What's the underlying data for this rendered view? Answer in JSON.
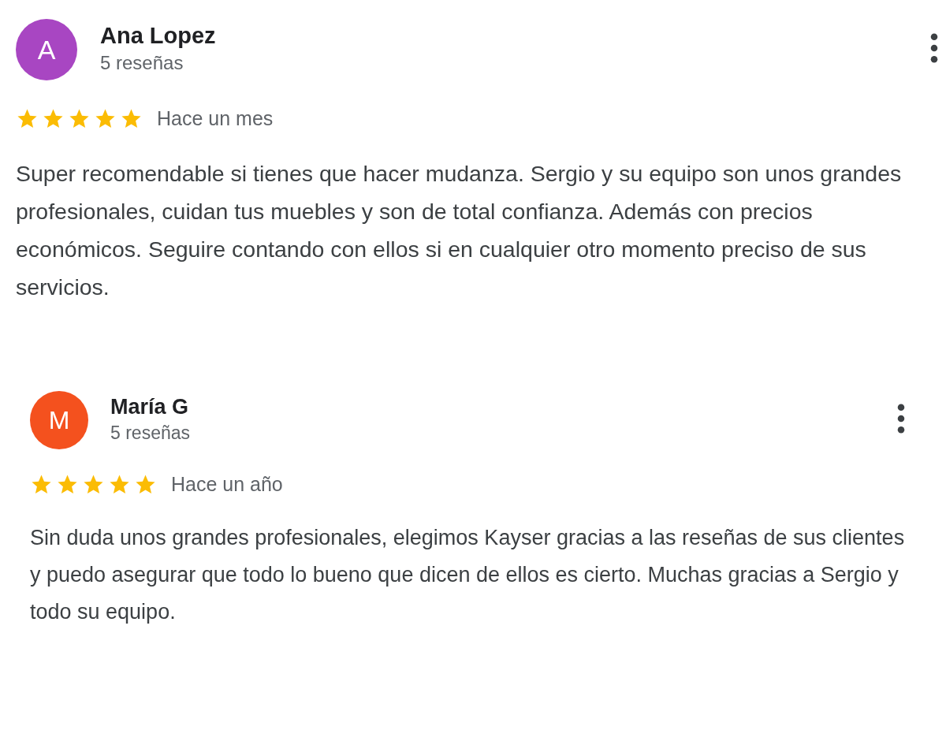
{
  "reviews": [
    {
      "initial": "A",
      "color": "#a846c2",
      "name": "Ana Lopez",
      "count": "5 reseñas",
      "stars": 5,
      "time": "Hace un mes",
      "text": "Super recomendable si tienes que hacer mudanza. Sergio y su equipo son unos grandes profesionales, cuidan tus muebles y son de total confianza. Además con precios económicos. Seguire contando con ellos si en cualquier otro momento preciso de sus servicios."
    },
    {
      "initial": "M",
      "color": "#f4511e",
      "name": "María G",
      "count": "5 reseñas",
      "stars": 5,
      "time": "Hace un año",
      "text": "Sin duda unos grandes profesionales, elegimos Kayser gracias a las reseñas de sus clientes y puedo asegurar que todo lo bueno que dicen de ellos es cierto. Muchas gracias a Sergio y todo su equipo."
    }
  ]
}
